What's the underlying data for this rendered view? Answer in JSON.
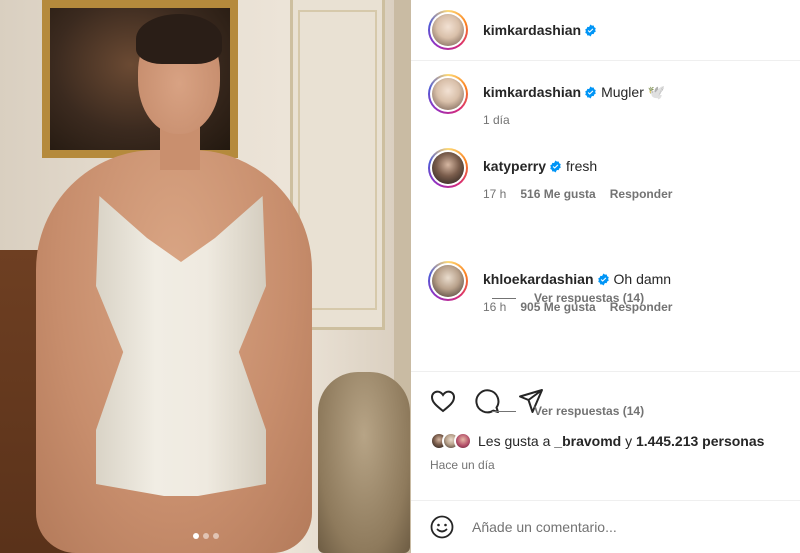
{
  "post": {
    "username": "kimkardashian",
    "carousel_dots": 3
  },
  "caption": {
    "username": "kimkardashian",
    "text": "Mugler 🕊️",
    "time": "1 día"
  },
  "comments": [
    {
      "username": "katyperry",
      "text": "fresh",
      "time": "17 h",
      "likes": "516 Me gusta",
      "reply_label": "Responder",
      "view_replies": "Ver respuestas (14)"
    },
    {
      "username": "khloekardashian",
      "text": "Oh damn",
      "time": "16 h",
      "likes": "905 Me gusta",
      "reply_label": "Responder",
      "view_replies": "Ver respuestas (14)"
    }
  ],
  "likes": {
    "prefix": "Les gusta a",
    "user": "_bravomd",
    "connector": "y",
    "count": "1.445.213 personas"
  },
  "date": "Hace un día",
  "add_comment": {
    "placeholder": "Añade un comentario..."
  },
  "colors": {
    "verified": "#0095f6",
    "muted_text": "#737373",
    "text": "#262626"
  },
  "icons": [
    "heart-icon",
    "comment-icon",
    "share-icon",
    "emoji-icon",
    "verified-icon"
  ]
}
